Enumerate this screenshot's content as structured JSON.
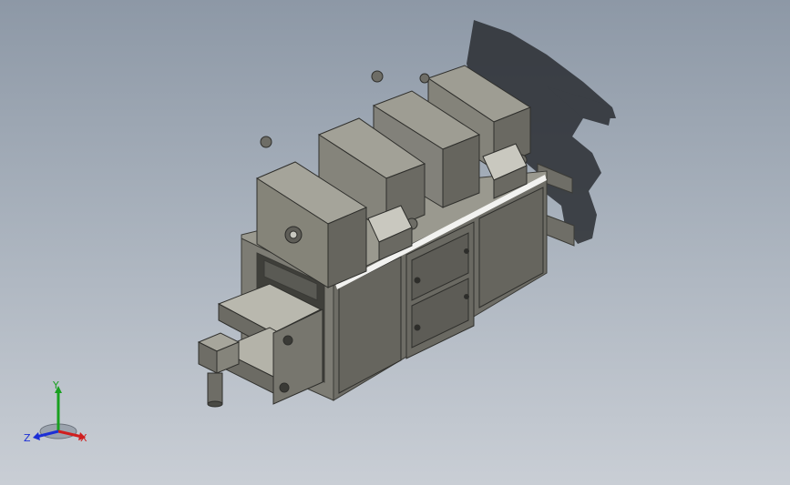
{
  "viewport": {
    "background_top": "#8d98a6",
    "background_bottom": "#c9ced5",
    "model_color": "#7b7a72",
    "model_dark": "#4a4a44",
    "model_light": "#a9a89e",
    "shadow_color": "#2b2e33"
  },
  "triad": {
    "y_label": "Y",
    "z_label": "Z",
    "x_label": "X",
    "y_color": "#19a020",
    "z_color": "#1c2fd6",
    "x_color": "#d01e1e"
  }
}
